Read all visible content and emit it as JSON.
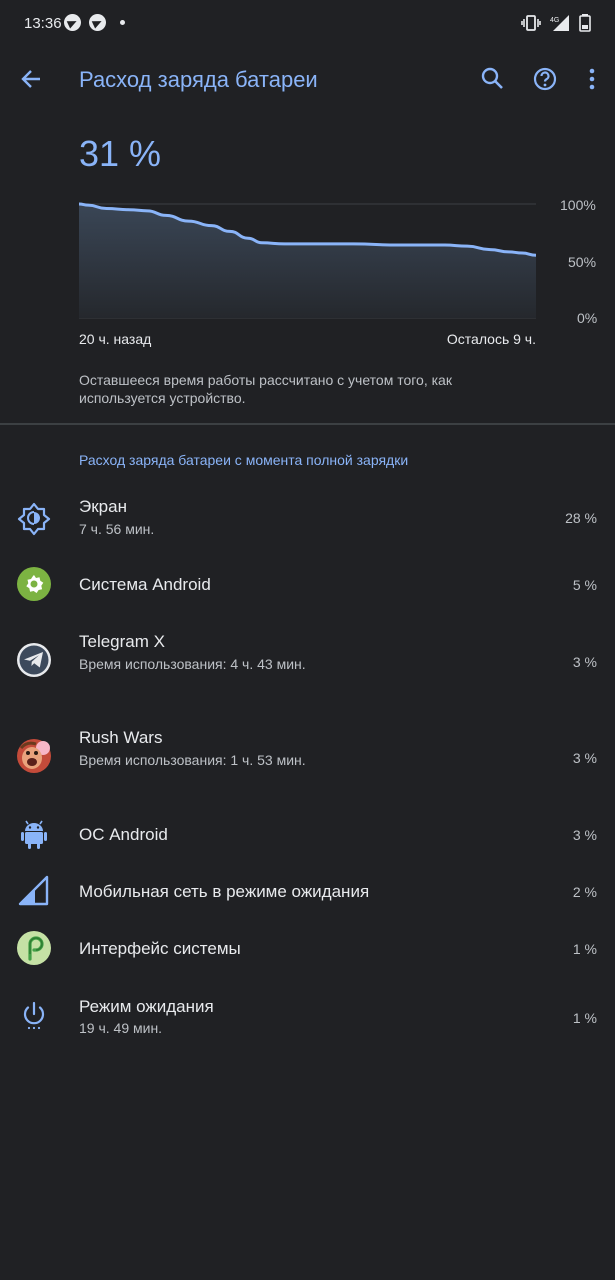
{
  "status_bar": {
    "time": "13:36",
    "left_icons": [
      "telegram-icon",
      "telegram-icon",
      "dot"
    ],
    "right_icons": [
      "vibrate-icon",
      "signal-4g-icon",
      "battery-icon"
    ],
    "network": "4G"
  },
  "app_bar": {
    "title": "Расход заряда батареи",
    "actions": [
      "search-icon",
      "help-icon",
      "more-vert-icon"
    ]
  },
  "battery": {
    "percent_label": "31 %"
  },
  "chart_data": {
    "type": "area",
    "y_ticks": [
      "100%",
      "50%",
      "0%"
    ],
    "ylim": [
      0,
      100
    ],
    "x_left_label": "20 ч. назад",
    "x_right_label": "Осталось 9 ч.",
    "x_hours": [
      -20,
      -19.6,
      -18.8,
      -17.8,
      -17.0,
      -16.2,
      -15.2,
      -14.2,
      -13.4,
      -12.6,
      -12.0,
      -11.0,
      -10.0,
      -8.0,
      -6.0,
      -4.0,
      -3.0,
      -2.0,
      -1.2,
      -0.6,
      0
    ],
    "values": [
      100,
      99,
      96,
      95,
      94,
      90,
      85,
      81,
      76,
      70,
      66,
      65,
      65,
      65,
      64,
      64,
      63,
      60,
      58,
      57,
      55
    ],
    "color": "#8ab4f8"
  },
  "note": "Оставшееся время работы рассчитано с учетом того, как используется устройство.",
  "section_title": "Расход заряда батареи с момента полной зарядки",
  "items": [
    {
      "icon": "brightness-icon",
      "title": "Экран",
      "subtitle": "7 ч. 56 мин.",
      "percent": "28 %"
    },
    {
      "icon": "android-system-gear-icon",
      "title": "Система Android",
      "subtitle": "",
      "percent": "5 %"
    },
    {
      "icon": "telegram-x-icon",
      "title": "Telegram X",
      "subtitle": "Время использования: 4 ч. 43 мин.",
      "percent": "3 %"
    },
    {
      "icon": "rush-wars-icon",
      "title": "Rush Wars",
      "subtitle": "Время использования: 1 ч. 53 мин.",
      "percent": "3 %"
    },
    {
      "icon": "android-robot-icon",
      "title": "ОС Android",
      "subtitle": "",
      "percent": "3 %"
    },
    {
      "icon": "cell-signal-icon",
      "title": "Мобильная сеть в режиме ожидания",
      "subtitle": "",
      "percent": "2 %"
    },
    {
      "icon": "system-ui-icon",
      "title": "Интерфейс системы",
      "subtitle": "",
      "percent": "1 %"
    },
    {
      "icon": "power-standby-icon",
      "title": "Режим ожидания",
      "subtitle": "19 ч. 49 мин.",
      "percent": "1 %"
    }
  ]
}
